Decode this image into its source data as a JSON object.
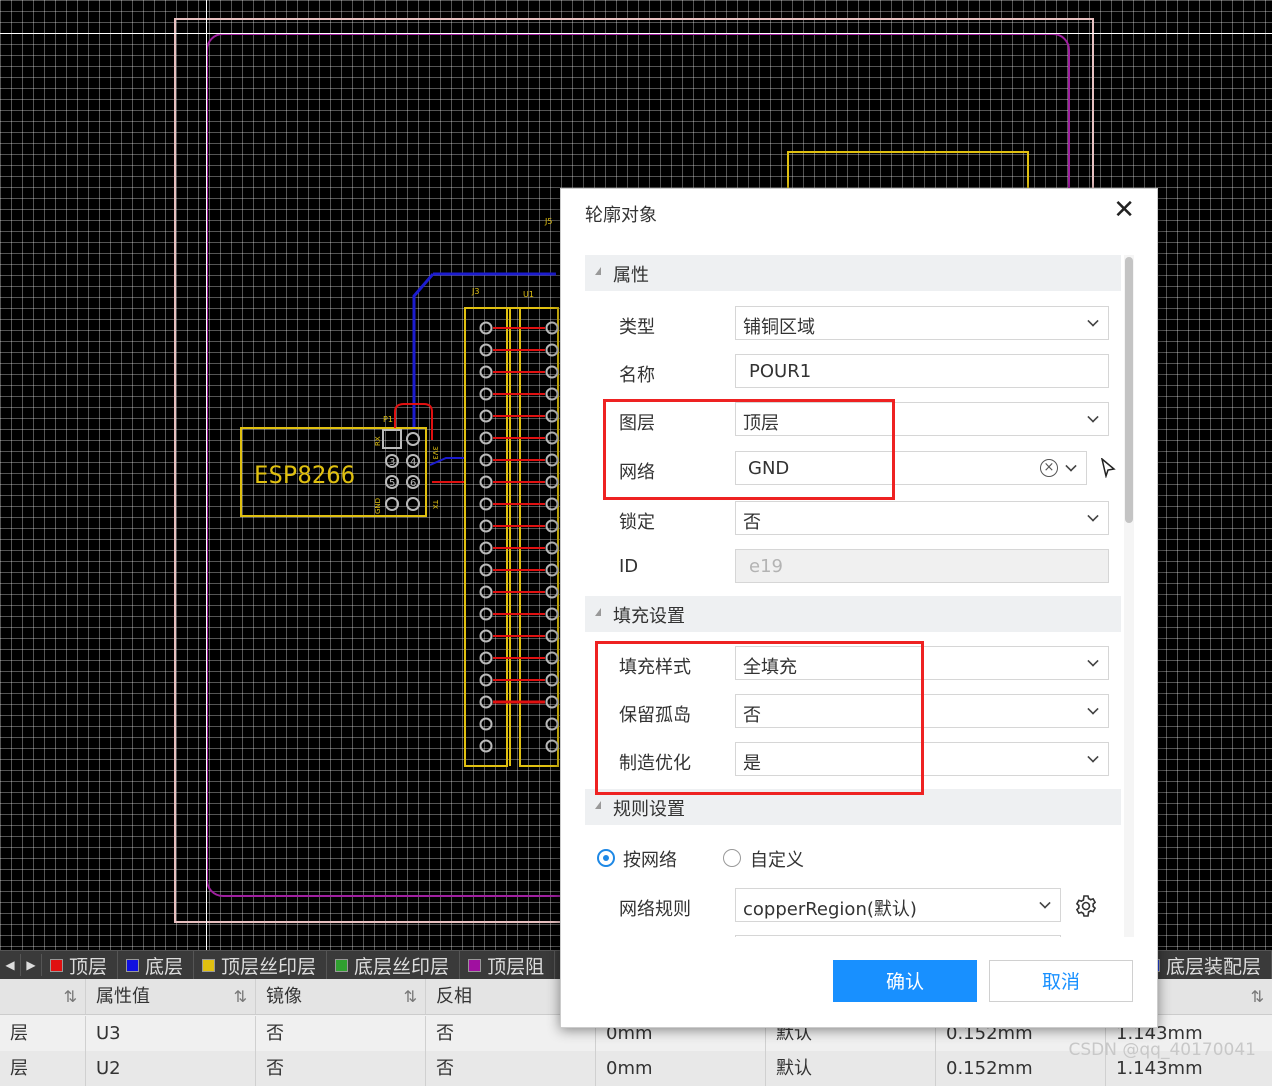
{
  "canvas": {
    "module_label": "ESP8266",
    "header_labels": {
      "j3": "J3",
      "u1": "U1",
      "j5": "J5",
      "p1": "P1"
    },
    "pin_labels": {
      "rx": "RX",
      "v33": "3V3",
      "gnd": "GND",
      "tx": "TX"
    },
    "pin_numbers": [
      "3",
      "4",
      "5",
      "6"
    ]
  },
  "layerbar": {
    "tabs": [
      {
        "label": "顶层",
        "color": "#e01010"
      },
      {
        "label": "底层",
        "color": "#1010e0"
      },
      {
        "label": "顶层丝印层",
        "color": "#e0c010"
      },
      {
        "label": "底层丝印层",
        "color": "#30a030"
      },
      {
        "label": "顶层阻",
        "color": "#a010a0"
      }
    ],
    "right_tab": {
      "label": "底层装配层",
      "color": "#2040d0"
    }
  },
  "table": {
    "headers": [
      "",
      "属性值",
      "镜像",
      "反相"
    ],
    "rows": [
      [
        "层",
        "U3",
        "否",
        "否",
        "0mm",
        "默认",
        "0.152mm",
        "1.143mm"
      ],
      [
        "层",
        "U2",
        "否",
        "否",
        "0mm",
        "默认",
        "0.152mm",
        "1.143mm"
      ]
    ],
    "watermark": "CSDN @qq_40170041"
  },
  "dialog": {
    "title": "轮廓对象",
    "sections": {
      "properties": "属性",
      "fill": "填充设置",
      "rules": "规则设置"
    },
    "fields": {
      "type": {
        "label": "类型",
        "value": "铺铜区域"
      },
      "name": {
        "label": "名称",
        "value": "POUR1"
      },
      "layer": {
        "label": "图层",
        "value": "顶层"
      },
      "net": {
        "label": "网络",
        "value": "GND"
      },
      "locked": {
        "label": "锁定",
        "value": "否"
      },
      "id": {
        "label": "ID",
        "value": "e19"
      },
      "fill_style": {
        "label": "填充样式",
        "value": "全填充"
      },
      "keep_islands": {
        "label": "保留孤岛",
        "value": "否"
      },
      "mfg_optimize": {
        "label": "制造优化",
        "value": "是"
      },
      "net_rule": {
        "label": "网络规则",
        "value": "copperRegion(默认)"
      }
    },
    "rule_mode": {
      "by_net": "按网络",
      "custom": "自定义",
      "selected": "by_net"
    },
    "buttons": {
      "ok": "确认",
      "cancel": "取消"
    }
  }
}
